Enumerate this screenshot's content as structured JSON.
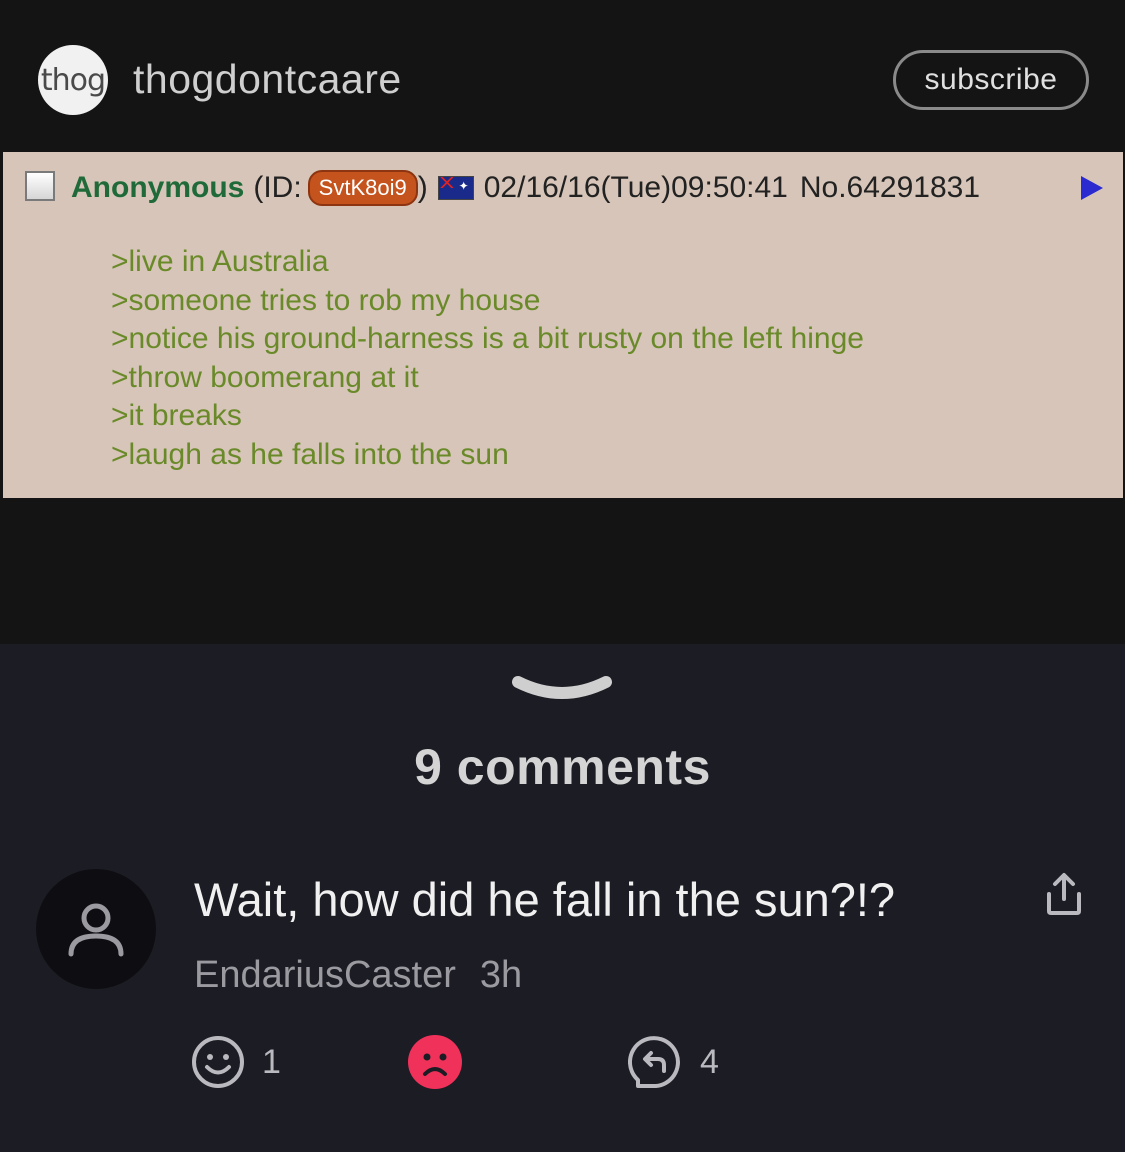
{
  "header": {
    "avatar_text": "thog",
    "channel_name": "thogdontcaare",
    "subscribe_label": "subscribe"
  },
  "post": {
    "name": "Anonymous",
    "id_prefix": "(ID:",
    "id": "SvtK8oi9",
    "id_suffix": ")",
    "datetime": "02/16/16(Tue)09:50:41",
    "number": "No.64291831",
    "lines": [
      ">live in Australia",
      ">someone tries to rob my house",
      ">notice his ground-harness is a bit rusty on the left hinge",
      ">throw boomerang at it",
      ">it breaks",
      ">laugh as he falls into the sun"
    ]
  },
  "comments": {
    "count_label": "9 comments",
    "items": [
      {
        "text": "Wait, how did he fall in the sun?!?",
        "author": "EndariusCaster",
        "time": "3h",
        "likes": "1",
        "replies": "4"
      }
    ]
  },
  "colors": {
    "background": "#141414",
    "sheet": "#1c1c24",
    "post_bg": "#d6c5b8",
    "greentext": "#6a8a2a",
    "name_green": "#1f6a38",
    "dislike_red": "#f0315a"
  },
  "icons": [
    "checkbox-icon",
    "flag-icon",
    "arrow-icon",
    "chevron-down-icon",
    "user-icon",
    "share-icon",
    "smile-icon",
    "sad-icon",
    "reply-icon"
  ]
}
